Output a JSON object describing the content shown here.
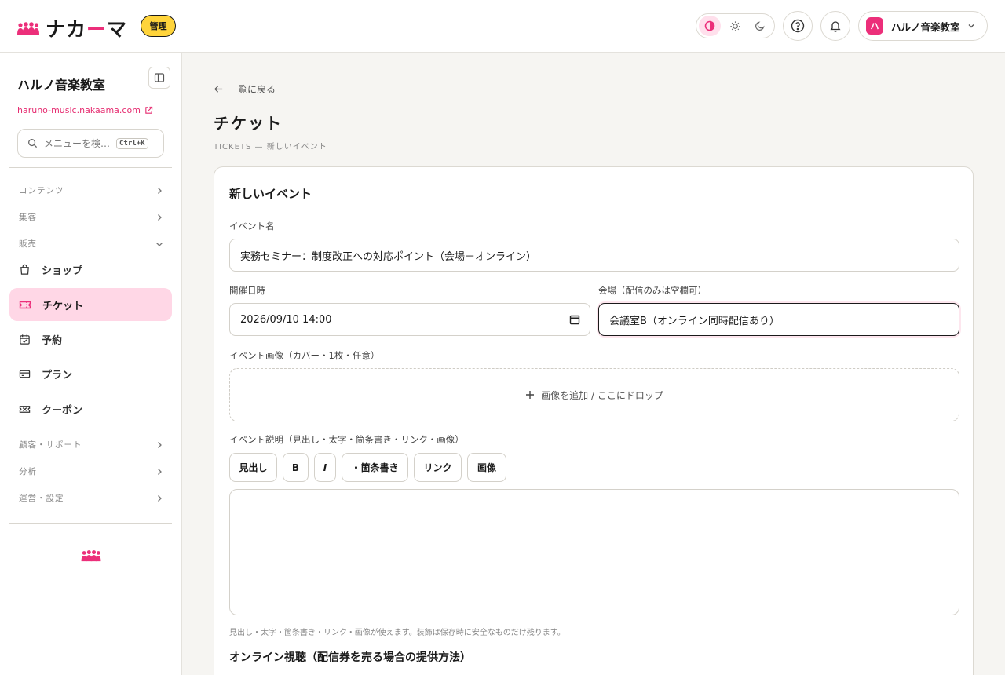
{
  "header": {
    "logo_text_a": "ナカ",
    "logo_text_b": "ー",
    "logo_text_c": "マ",
    "badge": "管理",
    "account_avatar": "ハ",
    "account_name": "ハルノ音楽教室",
    "colors": {
      "brand": "#ec2f7a",
      "badge": "#ffd43b",
      "active_nav": "#ffd7e6"
    }
  },
  "sidebar": {
    "org_name": "ハルノ音楽教室",
    "org_url": "haruno-music.nakaama.com",
    "search_placeholder": "メニューを検…",
    "search_shortcut": "Ctrl+K",
    "groups": {
      "contents": "コンテンツ",
      "marketing": "集客",
      "sales": "販売",
      "customers": "顧客・サポート",
      "analytics": "分析",
      "operations": "運営・設定"
    },
    "items": {
      "shop": "ショップ",
      "tickets": "チケット",
      "reservations": "予約",
      "plans": "プラン",
      "coupons": "クーポン"
    }
  },
  "main": {
    "back_label": "一覧に戻る",
    "title": "チケット",
    "subtitle": "TICKETS — 新しいイベント",
    "form": {
      "card_title": "新しいイベント",
      "event_name_label": "イベント名",
      "event_name_value": "実務セミナー：制度改正への対応ポイント（会場＋オンライン）",
      "datetime_label": "開催日時",
      "datetime_value": "2026/09/10 14:00",
      "venue_label": "会場（配信のみは空欄可）",
      "venue_value": "会議室B（オンライン同時配信あり）",
      "image_label": "イベント画像（カバー・1枚・任意）",
      "image_drop": "画像を追加 / ここにドロップ",
      "description_label": "イベント説明（見出し・太字・箇条書き・リンク・画像）",
      "toolbar": {
        "heading": "見出し",
        "bold": "B",
        "italic": "I",
        "bullet": "・箇条書き",
        "link": "リンク",
        "image": "画像"
      },
      "editor_hint": "見出し・太字・箇条書き・リンク・画像が使えます。装飾は保存時に安全なものだけ残ります。",
      "online_section": "オンライン視聴（配信券を売る場合の提供方法）"
    }
  }
}
